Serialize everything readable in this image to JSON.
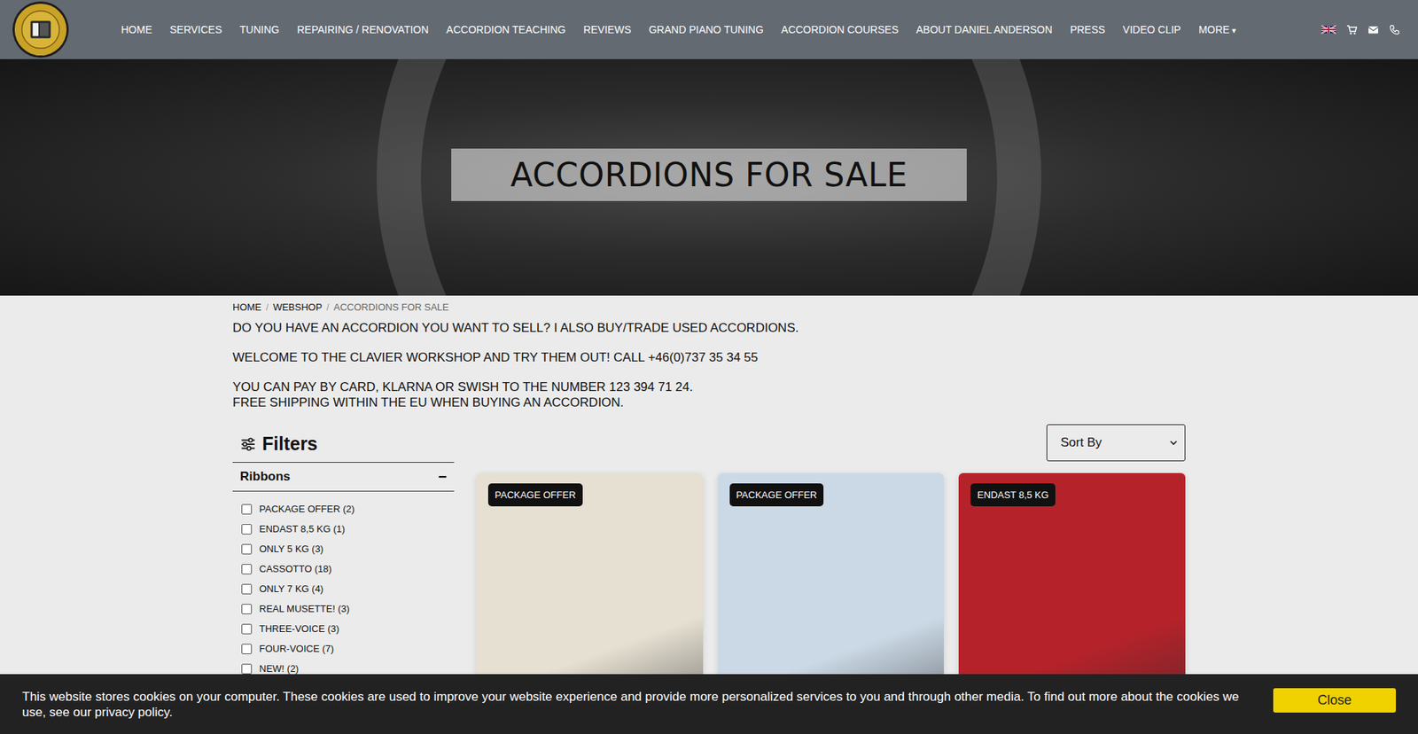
{
  "header": {
    "nav": [
      "HOME",
      "SERVICES",
      "TUNING",
      "REPAIRING / RENOVATION",
      "ACCORDION TEACHING",
      "REVIEWS",
      "GRAND PIANO TUNING",
      "ACCORDION COURSES",
      "ABOUT DANIEL ANDERSON",
      "PRESS",
      "VIDEO CLIP",
      "MORE"
    ],
    "more_caret": "▾"
  },
  "hero": {
    "title": "ACCORDIONS FOR SALE"
  },
  "breadcrumb": [
    "HOME",
    "WEBSHOP",
    "ACCORDIONS FOR SALE"
  ],
  "breadcrumb_separator": "/",
  "intro": [
    "DO YOU HAVE AN ACCORDION YOU WANT TO SELL? I ALSO BUY/TRADE USED ACCORDIONS.",
    "WELCOME TO THE CLAVIER WORKSHOP AND TRY THEM OUT! CALL +46(0)737 35 34 55",
    "YOU CAN PAY BY CARD, KLARNA OR SWISH TO THE NUMBER 123 394 71 24.",
    "FREE SHIPPING WITHIN THE EU WHEN BUYING AN ACCORDION."
  ],
  "filters": {
    "title": "Filters",
    "section": {
      "title": "Ribbons",
      "toggle": "−",
      "expanded": true,
      "items": [
        {
          "label": "PACKAGE OFFER (2)",
          "checked": false
        },
        {
          "label": "ENDAST 8,5 KG (1)",
          "checked": false
        },
        {
          "label": "ONLY 5 KG (3)",
          "checked": false
        },
        {
          "label": "CASSOTTO (18)",
          "checked": false
        },
        {
          "label": "ONLY 7 KG (4)",
          "checked": false
        },
        {
          "label": "REAL MUSETTE! (3)",
          "checked": false
        },
        {
          "label": "THREE-VOICE (3)",
          "checked": false
        },
        {
          "label": "FOUR-VOICE (7)",
          "checked": false
        },
        {
          "label": "NEW! (2)",
          "checked": false
        }
      ]
    }
  },
  "sort": {
    "placeholder": "Sort By"
  },
  "products": [
    {
      "ribbon": "PACKAGE OFFER",
      "color": "#e6e0d2"
    },
    {
      "ribbon": "PACKAGE OFFER",
      "color": "#cbd9e6"
    },
    {
      "ribbon": "ENDAST 8,5 KG",
      "color": "#b5222a"
    }
  ],
  "cookie": {
    "text": "This website stores cookies on your computer. These cookies are used to improve your website experience and provide more personalized services to you and through other media. To find out more about the cookies we use, see our privacy policy.",
    "button": "Close"
  }
}
